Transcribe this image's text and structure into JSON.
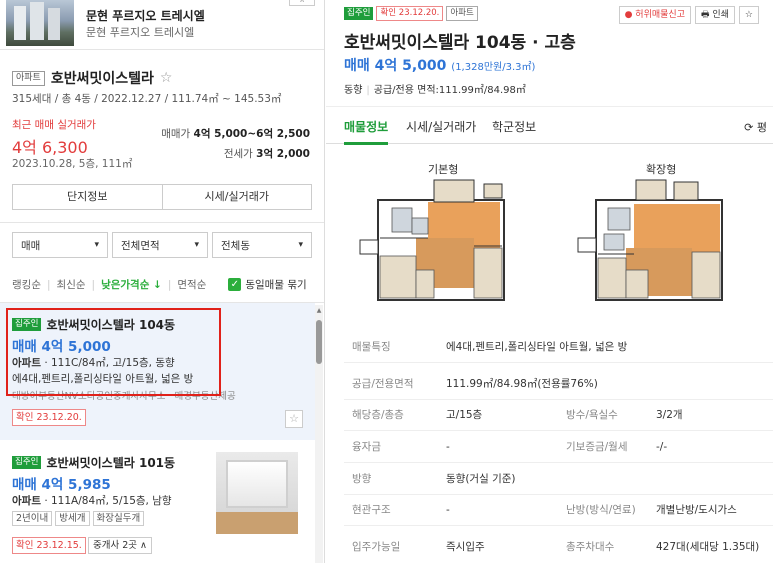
{
  "complex": {
    "name": "문현 푸르지오 트레시엘",
    "sub": "문현 푸르지오 트레시엘"
  },
  "apartment": {
    "type_tag": "아파트",
    "name": "호반써밋이스텔라",
    "meta": "315세대 / 총 4동 / 2022.12.27 / 111.74㎡ ~ 145.53㎡",
    "recent_label": "최근 매매 실거래가",
    "recent_price": "4억 6,300",
    "recent_date": "2023.10.28, 5층, 111㎡",
    "sale_range_label": "매매가",
    "sale_range": "4억 5,000~6억 2,500",
    "jeonse_label": "전세가",
    "jeonse": "3억 2,000",
    "btn_complex": "단지정보",
    "btn_price": "시세/실거래가"
  },
  "filters": {
    "trade": "매매",
    "area": "전체면적",
    "dong": "전체동"
  },
  "sort": {
    "ranking": "랭킹순",
    "latest": "최신순",
    "lowprice": "낮은가격순 ↓",
    "area": "면적순",
    "same_listing": "동일매물 묶기"
  },
  "listings": [
    {
      "badge": "집주인",
      "title": "호반써밋이스텔라 104동",
      "price": "매매 4억 5,000",
      "spec_type": "아파트",
      "spec": "111C/84㎡, 고/15층, 동향",
      "desc": "에4대,펜트리,폴리싱타일 아트월, 넓은 방",
      "agent": "대방이부동산NV소타공인중개사사무소 · 매경부동산제공",
      "confirm": "확인 23.12.20."
    },
    {
      "badge": "집주인",
      "title": "호반써밋이스텔라 101동",
      "price": "매매 4억 5,985",
      "spec_type": "아파트",
      "spec": "111A/84㎡, 5/15층, 남향",
      "tag1": "2년이내",
      "tag2": "방세개",
      "tag3": "화장실두개",
      "confirm": "확인 23.12.15.",
      "agent_btn": "중개사 2곳 ∧"
    }
  ],
  "detail": {
    "badge_owner": "집주인",
    "badge_confirm": "확인 23.12.20.",
    "badge_type": "아파트",
    "report": "● 허위매물신고",
    "print": "🖶 인쇄",
    "title": "호반써밋이스텔라 104동 · 고층",
    "price": "매매 4억 5,000",
    "price_per": "(1,328만원/3.3㎡)",
    "sub_dong": "동향",
    "sub_area": "공급/전용 면적:111.99㎡/84.98㎡",
    "tabs": [
      "매물정보",
      "시세/실거래가",
      "학군정보"
    ],
    "refresh": "평",
    "plan_basic": "기본형",
    "plan_ext": "확장형",
    "rows": [
      {
        "k": "매물특징",
        "v": "에4대,펜트리,폴리싱타일 아트월, 넓은 방"
      },
      {
        "k": "공급/전용면적",
        "v": "111.99㎡/84.98㎡(전용률76%)"
      },
      {
        "k": "해당층/총층",
        "v": "고/15층",
        "k2": "방수/욕실수",
        "v2": "3/2개"
      },
      {
        "k": "융자금",
        "v": "-",
        "k2": "기보증금/월세",
        "v2": "-/-"
      },
      {
        "k": "방향",
        "v": "동향(거실 기준)"
      },
      {
        "k": "현관구조",
        "v": "-",
        "k2": "난방(방식/연료)",
        "v2": "개별난방/도시가스"
      },
      {
        "k": "입주가능일",
        "v": "즉시입주",
        "k2": "총주차대수",
        "v2": "427대(세대당 1.35대)"
      }
    ]
  },
  "colors": {
    "accent_green": "#1f9d3b",
    "price_blue": "#2e74d6",
    "alert_red": "#e23c3c",
    "highlight_frame": "#e0211a"
  }
}
